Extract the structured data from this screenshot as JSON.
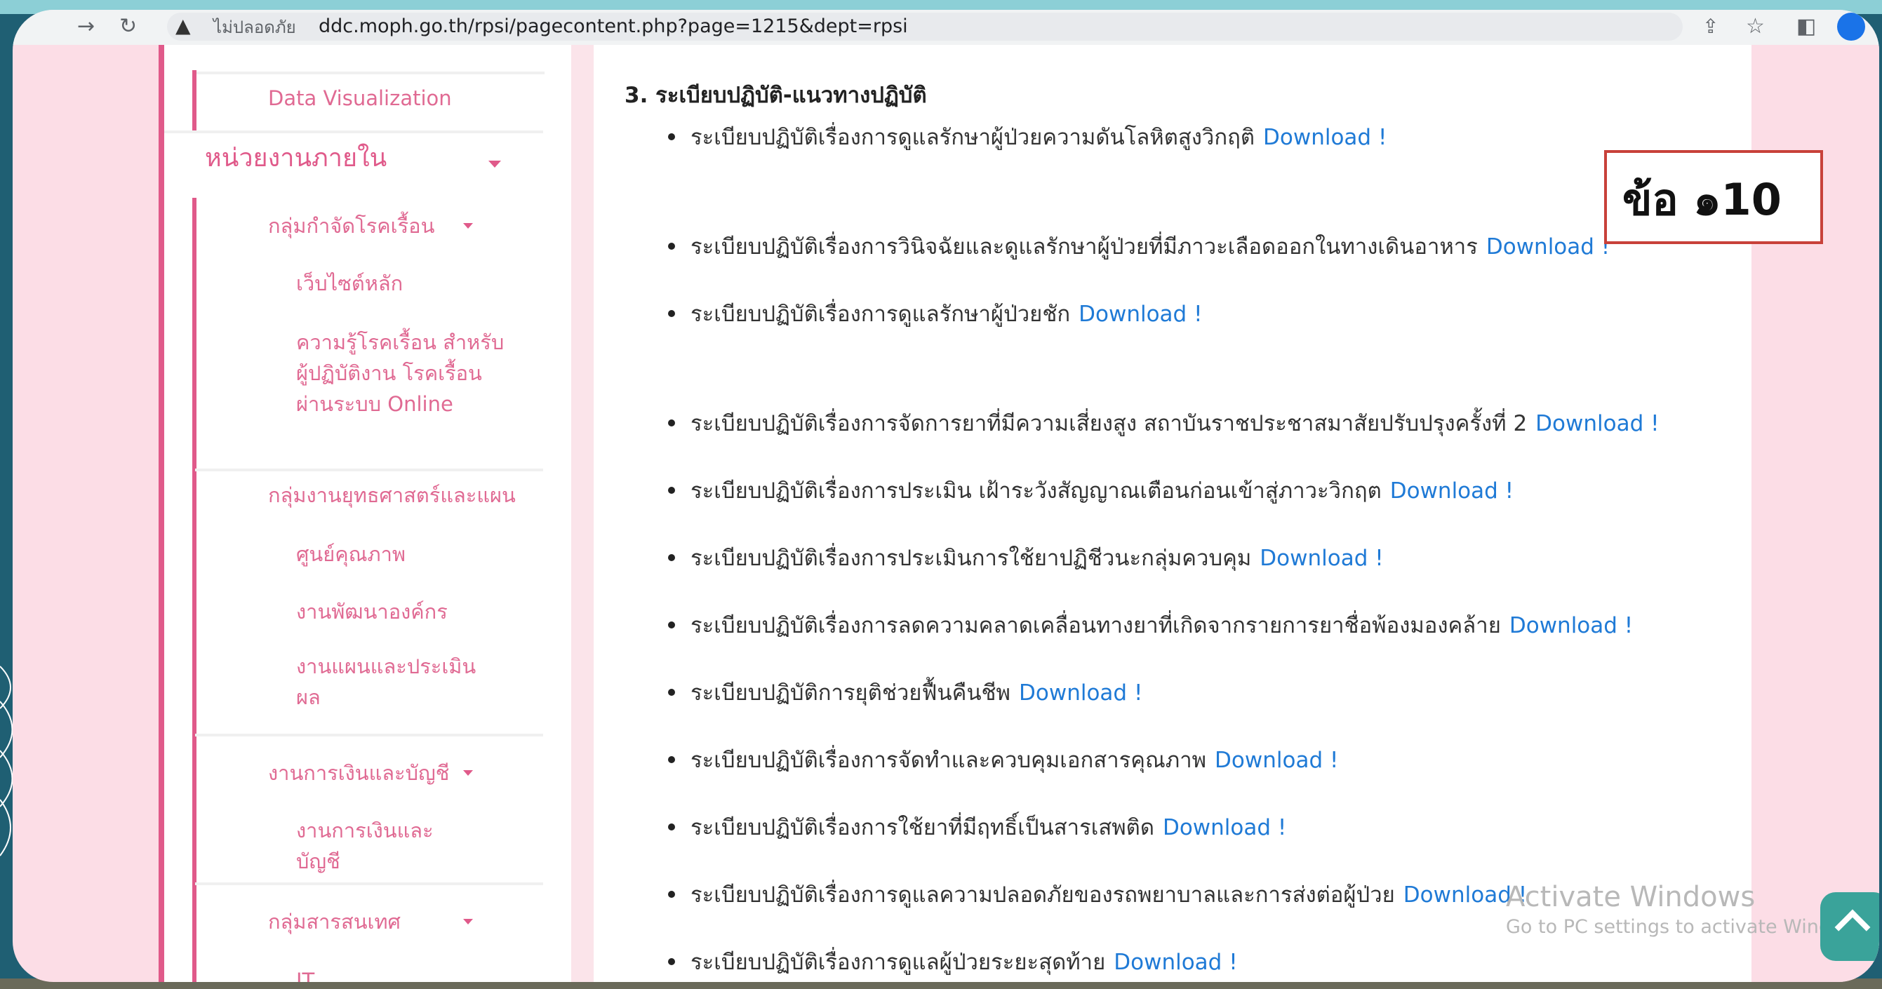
{
  "browser": {
    "not_secure_label": "ไม่ปลอดภัย",
    "url": "ddc.moph.go.th/rpsi/pagecontent.php?page=1215&dept=rpsi",
    "icons": [
      "back-arrow-icon",
      "reload-icon",
      "warning-icon",
      "share-icon",
      "star-icon",
      "sidepanel-icon",
      "profile-icon"
    ]
  },
  "sidebar": {
    "data_vis": "Data Visualization",
    "section_internal": "หน่วยงานภายใน",
    "group_leprosy": "กลุ่มกำจัดโรคเรื้อน",
    "leprosy_main": "เว็บไซต์หลัก",
    "leprosy_knowledge": "ความรู้โรคเรื้อน สำหรับผู้ปฏิบัติงาน โรคเรื้อน ผ่านระบบ Online",
    "group_strategy": "กลุ่มงานยุทธศาสตร์และแผน",
    "quality_center": "ศูนย์คุณภาพ",
    "org_dev": "งานพัฒนาองค์กร",
    "plan_eval": "งานแผนและประเมิน ผล",
    "group_finance": "งานการเงินและบัญชี",
    "finance_item": "งานการเงินและ บัญชี",
    "group_it": "กลุ่มสารสนเทศ",
    "it_item": "IT"
  },
  "content": {
    "section_title": "3. ระเบียบปฏิบัติ-แนวทางปฏิบัติ",
    "download_label": "Download !",
    "items": [
      "ระเบียบปฏิบัติเรื่องการดูแลรักษาผู้ป่วยความดันโลหิตสูงวิกฤติ",
      "ระเบียบปฏิบัติเรื่องการวินิจฉัยและดูแลรักษาผู้ป่วยที่มีภาวะเลือดออกในทางเดินอาหาร",
      "ระเบียบปฏิบัติเรื่องการดูแลรักษาผู้ป่วยชัก",
      "ระเบียบปฏิบัติเรื่องการจัดการยาที่มีความเสี่ยงสูง สถาบันราชประชาสมาสัยปรับปรุงครั้งที่ 2",
      "ระเบียบปฏิบัติเรื่องการประเมิน เฝ้าระวังสัญญาณเตือนก่อนเข้าสู่ภาวะวิกฤต",
      "ระเบียบปฏิบัติเรื่องการประเมินการใช้ยาปฏิชีวนะกลุ่มควบคุม",
      "ระเบียบปฏิบัติเรื่องการลดความคลาดเคลื่อนทางยาที่เกิดจากรายการยาชื่อพ้องมองคล้าย",
      "ระเบียบปฏิบัติการยุติช่วยฟื้นคืนชีพ",
      "ระเบียบปฏิบัติเรื่องการจัดทำและควบคุมเอกสารคุณภาพ",
      "ระเบียบปฏิบัติเรื่องการใช้ยาที่มีฤทธิ์เป็นสารเสพติด",
      "ระเบียบปฏิบัติเรื่องการดูแลความปลอดภัยของรถพยาบาลและการส่งต่อผู้ป่วย",
      "ระเบียบปฏิบัติเรื่องการดูแลผู้ป่วยระยะสุดท้าย"
    ]
  },
  "callout": {
    "text": "ข้อ ๑10"
  },
  "watermark": {
    "line1": "Activate Windows",
    "line2": "Go to PC settings to activate Windows."
  },
  "colors": {
    "accent_pink": "#e05a8a",
    "link_blue": "#1f7ad6",
    "callout_border": "#c8413a",
    "scroll_button": "#3aa39a"
  }
}
